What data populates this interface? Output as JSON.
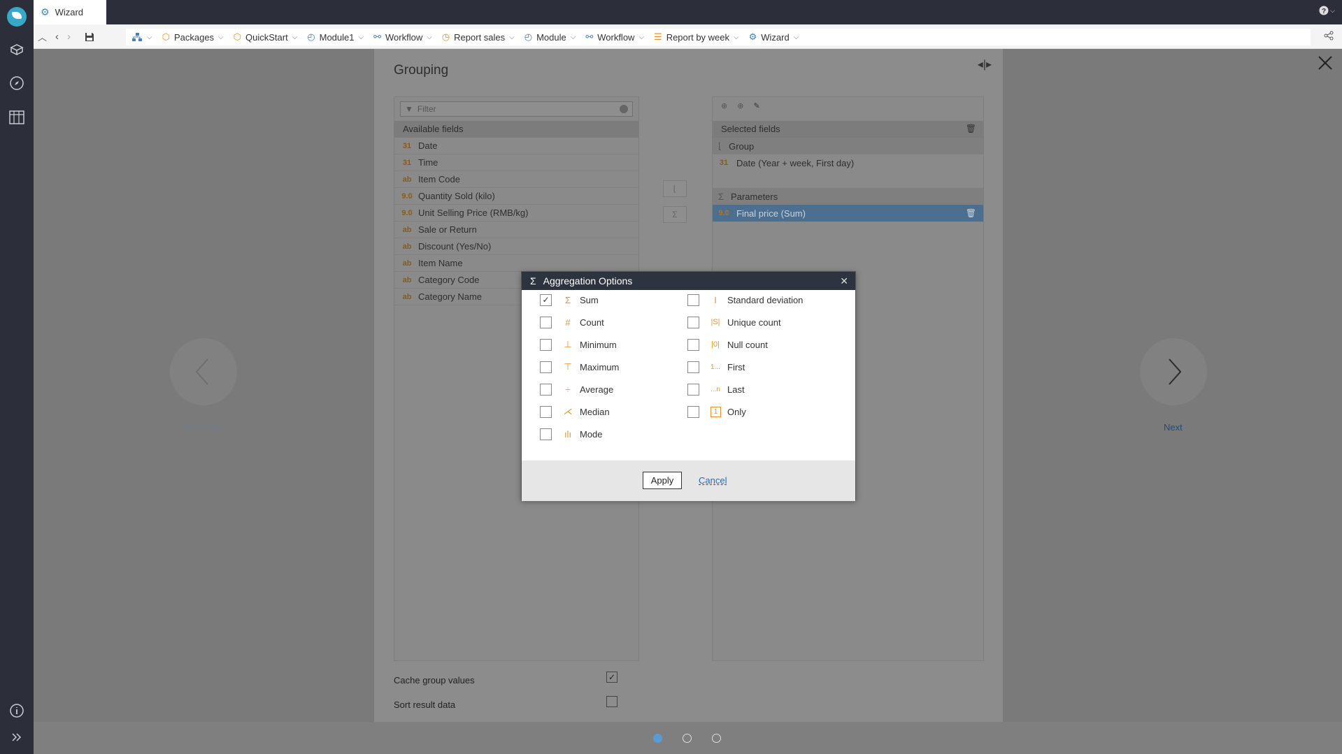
{
  "window": {
    "tab_title": "Wizard",
    "help_label": "?"
  },
  "breadcrumbs": [
    {
      "label": "",
      "icon": "hierarchy-icon"
    },
    {
      "label": "Packages",
      "icon": "package-icon"
    },
    {
      "label": "QuickStart",
      "icon": "package-icon"
    },
    {
      "label": "Module1",
      "icon": "module-icon"
    },
    {
      "label": "Workflow",
      "icon": "workflow-icon"
    },
    {
      "label": "Report sales",
      "icon": "report-icon"
    },
    {
      "label": "Module",
      "icon": "module-icon"
    },
    {
      "label": "Workflow",
      "icon": "workflow-icon"
    },
    {
      "label": "Report by week",
      "icon": "list-report-icon"
    },
    {
      "label": "Wizard",
      "icon": "gear-icon"
    }
  ],
  "panel": {
    "title": "Grouping",
    "filter_placeholder": "Filter",
    "available_header": "Available fields",
    "available_fields": [
      {
        "type": "31",
        "name": "Date"
      },
      {
        "type": "31",
        "name": "Time"
      },
      {
        "type": "ab",
        "name": "Item Code"
      },
      {
        "type": "9.0",
        "name": "Quantity Sold (kilo)"
      },
      {
        "type": "9.0",
        "name": "Unit Selling Price (RMB/kg)"
      },
      {
        "type": "ab",
        "name": "Sale or Return"
      },
      {
        "type": "ab",
        "name": "Discount (Yes/No)"
      },
      {
        "type": "ab",
        "name": "Item Name"
      },
      {
        "type": "ab",
        "name": "Category Code"
      },
      {
        "type": "ab",
        "name": "Category Name"
      }
    ],
    "selected_header": "Selected fields",
    "group_label": "Group",
    "group_field": "Date (Year + week, First day)",
    "parameters_label": "Parameters",
    "parameter_field": "Final price (Sum)",
    "options": [
      {
        "label": "Cache group values",
        "checked": true
      },
      {
        "label": "Sort result data",
        "checked": false
      }
    ]
  },
  "nav": {
    "previous": "Previous",
    "next": "Next"
  },
  "pagination": {
    "current": 1,
    "total": 3
  },
  "modal": {
    "title": "Aggregation Options",
    "left_options": [
      {
        "label": "Sum",
        "checked": true,
        "icon": "sum-icon"
      },
      {
        "label": "Count",
        "checked": false,
        "icon": "hash-icon"
      },
      {
        "label": "Minimum",
        "checked": false,
        "icon": "minimum-icon"
      },
      {
        "label": "Maximum",
        "checked": false,
        "icon": "maximum-icon"
      },
      {
        "label": "Average",
        "checked": false,
        "icon": "average-icon"
      },
      {
        "label": "Median",
        "checked": false,
        "icon": "median-icon"
      },
      {
        "label": "Mode",
        "checked": false,
        "icon": "mode-icon"
      }
    ],
    "right_options": [
      {
        "label": "Standard deviation",
        "checked": false,
        "icon": "stddev-icon"
      },
      {
        "label": "Unique count",
        "checked": false,
        "icon": "unique-count-icon"
      },
      {
        "label": "Null count",
        "checked": false,
        "icon": "null-count-icon"
      },
      {
        "label": "First",
        "checked": false,
        "icon": "first-icon"
      },
      {
        "label": "Last",
        "checked": false,
        "icon": "last-icon"
      },
      {
        "label": "Only",
        "checked": false,
        "icon": "only-icon"
      }
    ],
    "apply_label": "Apply",
    "cancel_label": "Cancel"
  },
  "colors": {
    "accent": "#5b9bd5",
    "icon_orange": "#e5952b",
    "header_dark": "#2e3340",
    "link": "#2a6aad"
  }
}
